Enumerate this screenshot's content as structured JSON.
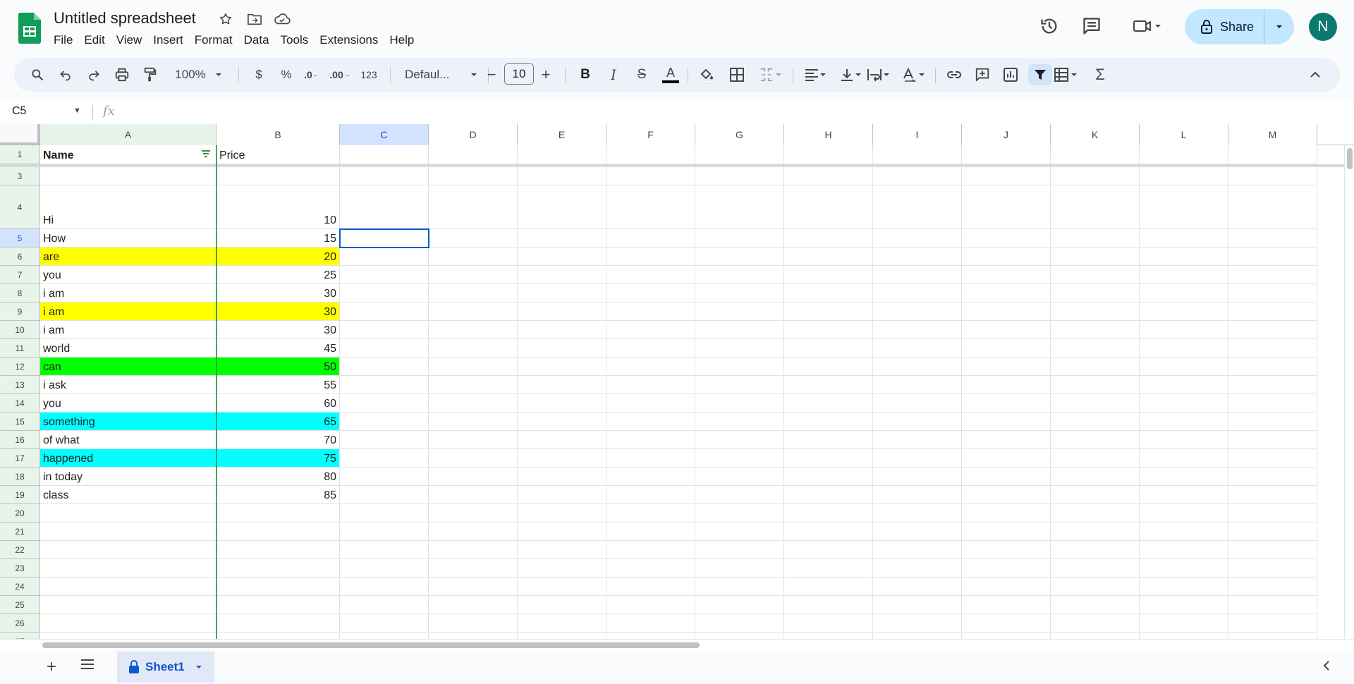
{
  "app": {
    "title": "Untitled spreadsheet",
    "menu": [
      "File",
      "Edit",
      "View",
      "Insert",
      "Format",
      "Data",
      "Tools",
      "Extensions",
      "Help"
    ],
    "share_label": "Share",
    "avatar_initial": "N"
  },
  "toolbar": {
    "zoom": "100%",
    "currency": "$",
    "percent": "%",
    "decrease_decimal": ".0",
    "increase_decimal": ".00",
    "number_format": "123",
    "font": "Defaul...",
    "font_size": "10",
    "bold": "B",
    "italic": "I",
    "strike": "S",
    "text_color_letter": "A",
    "text_color": "#000000",
    "function": "Σ"
  },
  "formula_bar": {
    "cell_ref": "C5",
    "fx_label": "fx",
    "content": ""
  },
  "grid": {
    "columns": [
      "A",
      "B",
      "C",
      "D",
      "E",
      "F",
      "G",
      "H",
      "I",
      "J",
      "K",
      "L",
      "M"
    ],
    "selected_column": "C",
    "selected_row": "5",
    "rows": [
      {
        "num": "1",
        "a": "Name",
        "b": "Price",
        "bg": ""
      },
      {
        "num": "3",
        "a": "",
        "b": "",
        "bg": ""
      },
      {
        "num": "4",
        "a": "Hi",
        "b": "10",
        "bg": ""
      },
      {
        "num": "5",
        "a": "How",
        "b": "15",
        "bg": ""
      },
      {
        "num": "6",
        "a": "are",
        "b": "20",
        "bg": "#ffff00"
      },
      {
        "num": "7",
        "a": "you",
        "b": "25",
        "bg": ""
      },
      {
        "num": "8",
        "a": "i am",
        "b": "30",
        "bg": ""
      },
      {
        "num": "9",
        "a": "i am",
        "b": "30",
        "bg": "#ffff00"
      },
      {
        "num": "10",
        "a": "i am",
        "b": "30",
        "bg": ""
      },
      {
        "num": "11",
        "a": "world",
        "b": "45",
        "bg": ""
      },
      {
        "num": "12",
        "a": "can",
        "b": "50",
        "bg": "#00ff00"
      },
      {
        "num": "13",
        "a": "i ask",
        "b": "55",
        "bg": ""
      },
      {
        "num": "14",
        "a": "you",
        "b": "60",
        "bg": ""
      },
      {
        "num": "15",
        "a": "something",
        "b": "65",
        "bg": "#00ffff"
      },
      {
        "num": "16",
        "a": "of what",
        "b": "70",
        "bg": ""
      },
      {
        "num": "17",
        "a": "happened",
        "b": "75",
        "bg": "#00ffff"
      },
      {
        "num": "18",
        "a": "in today",
        "b": "80",
        "bg": ""
      },
      {
        "num": "19",
        "a": "class",
        "b": "85",
        "bg": ""
      },
      {
        "num": "20",
        "a": "",
        "b": "",
        "bg": ""
      },
      {
        "num": "21",
        "a": "",
        "b": "",
        "bg": ""
      },
      {
        "num": "22",
        "a": "",
        "b": "",
        "bg": ""
      },
      {
        "num": "23",
        "a": "",
        "b": "",
        "bg": ""
      },
      {
        "num": "24",
        "a": "",
        "b": "",
        "bg": ""
      },
      {
        "num": "25",
        "a": "",
        "b": "",
        "bg": ""
      },
      {
        "num": "26",
        "a": "",
        "b": "",
        "bg": ""
      },
      {
        "num": "27",
        "a": "",
        "b": "",
        "bg": ""
      }
    ]
  },
  "sheets": {
    "active": "Sheet1"
  }
}
